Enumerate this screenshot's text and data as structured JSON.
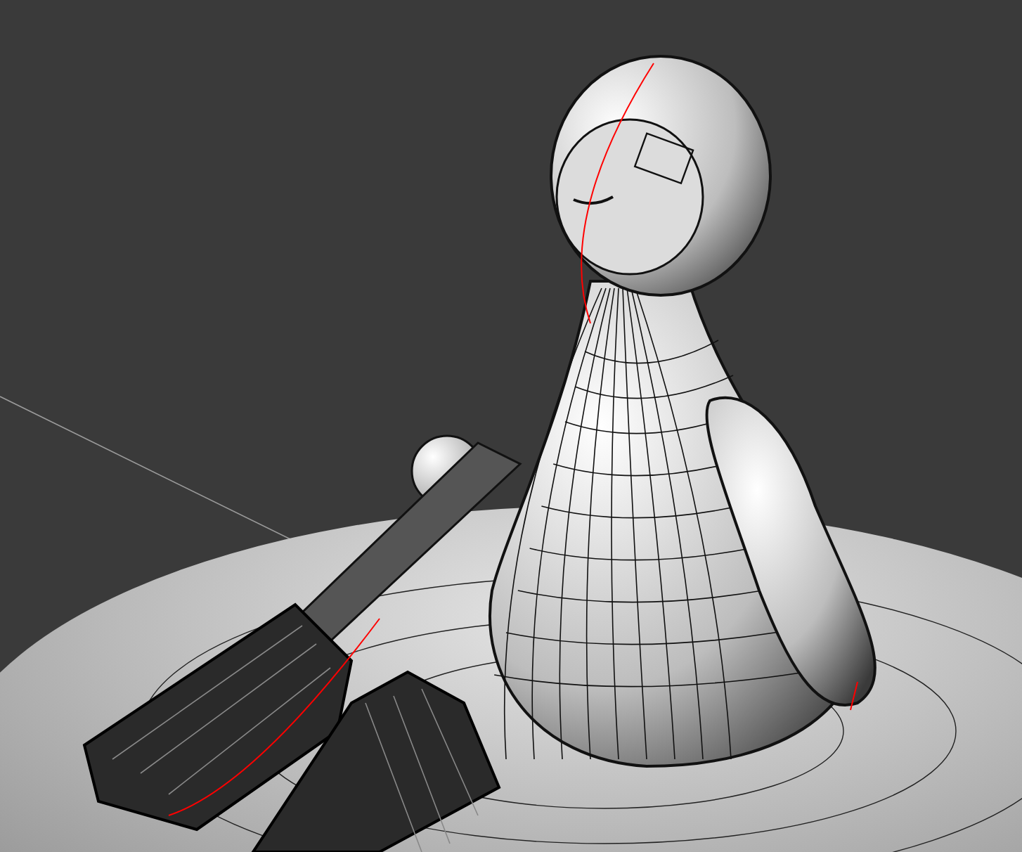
{
  "viewport": {
    "wireframe_overlay": true,
    "grid_line": true
  }
}
